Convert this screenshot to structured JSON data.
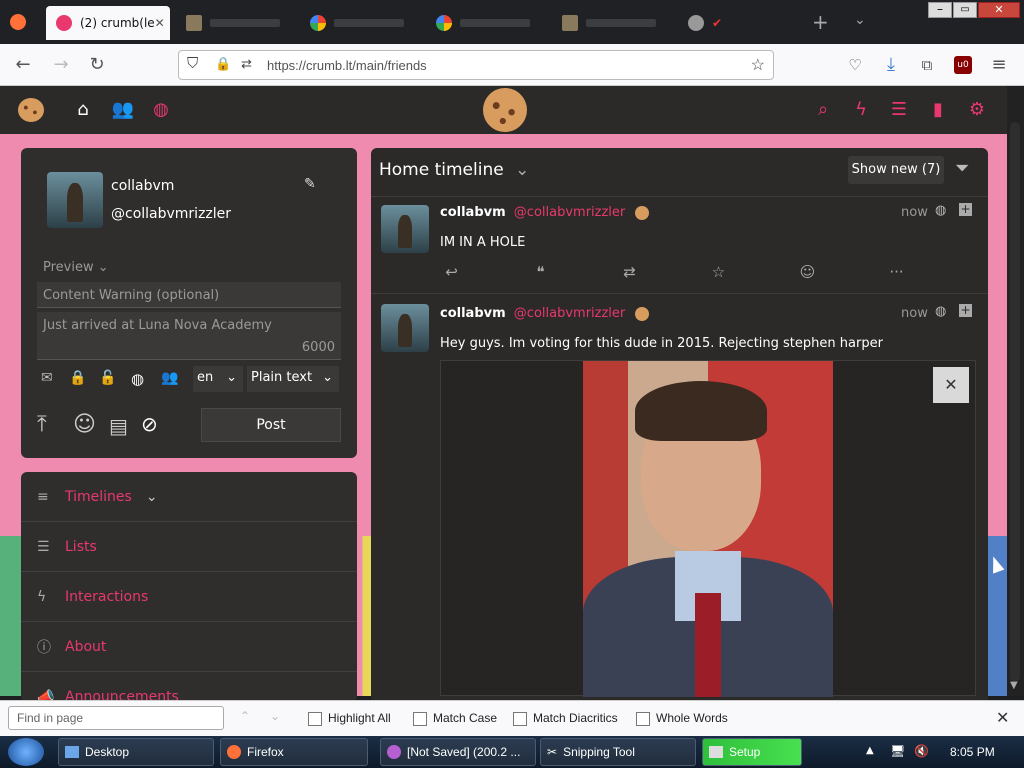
{
  "browser": {
    "tabs": [
      {
        "label": "(2) crumb(le",
        "active": true
      },
      {
        "label": "",
        "active": false
      },
      {
        "label": "",
        "active": false
      },
      {
        "label": "",
        "active": false
      },
      {
        "label": "",
        "active": false
      },
      {
        "label": "",
        "active": false
      }
    ],
    "url": "https://crumb.lt/main/friends"
  },
  "composer": {
    "display_name": "collabvm",
    "handle": "@collabvmrizzler",
    "preview_label": "Preview",
    "cw_placeholder": "Content Warning (optional)",
    "post_text": "Just arrived at Luna Nova Academy",
    "char_count": "6000",
    "language": "en",
    "format": "Plain text",
    "post_button": "Post"
  },
  "sidebar": {
    "items": [
      {
        "label": "Timelines",
        "icon": "menu-icon"
      },
      {
        "label": "Lists",
        "icon": "list-icon"
      },
      {
        "label": "Interactions",
        "icon": "bolt-icon"
      },
      {
        "label": "About",
        "icon": "info-icon"
      },
      {
        "label": "Announcements",
        "icon": "megaphone-icon"
      }
    ]
  },
  "timeline": {
    "title": "Home timeline",
    "show_new": "Show new (7)",
    "posts": [
      {
        "name": "collabvm",
        "handle": "@collabvmrizzler",
        "time": "now",
        "text": "IM IN A HOLE"
      },
      {
        "name": "collabvm",
        "handle": "@collabvmrizzler",
        "time": "now",
        "text": "Hey guys. Im voting for this dude in 2015. Rejecting stephen harper"
      }
    ]
  },
  "findbar": {
    "placeholder": "Find in page",
    "highlight_all": "Highlight All",
    "match_case": "Match Case",
    "match_diacritics": "Match Diacritics",
    "whole_words": "Whole Words"
  },
  "taskbar": {
    "items": [
      "Desktop",
      "Firefox",
      "[Not Saved]  (200.2 ...",
      "Snipping Tool",
      "Setup"
    ],
    "clock": "8:05 PM"
  },
  "colors": {
    "accent": "#e8386d",
    "panel": "#2f2e2d",
    "site_bg": "#f08bb0"
  }
}
